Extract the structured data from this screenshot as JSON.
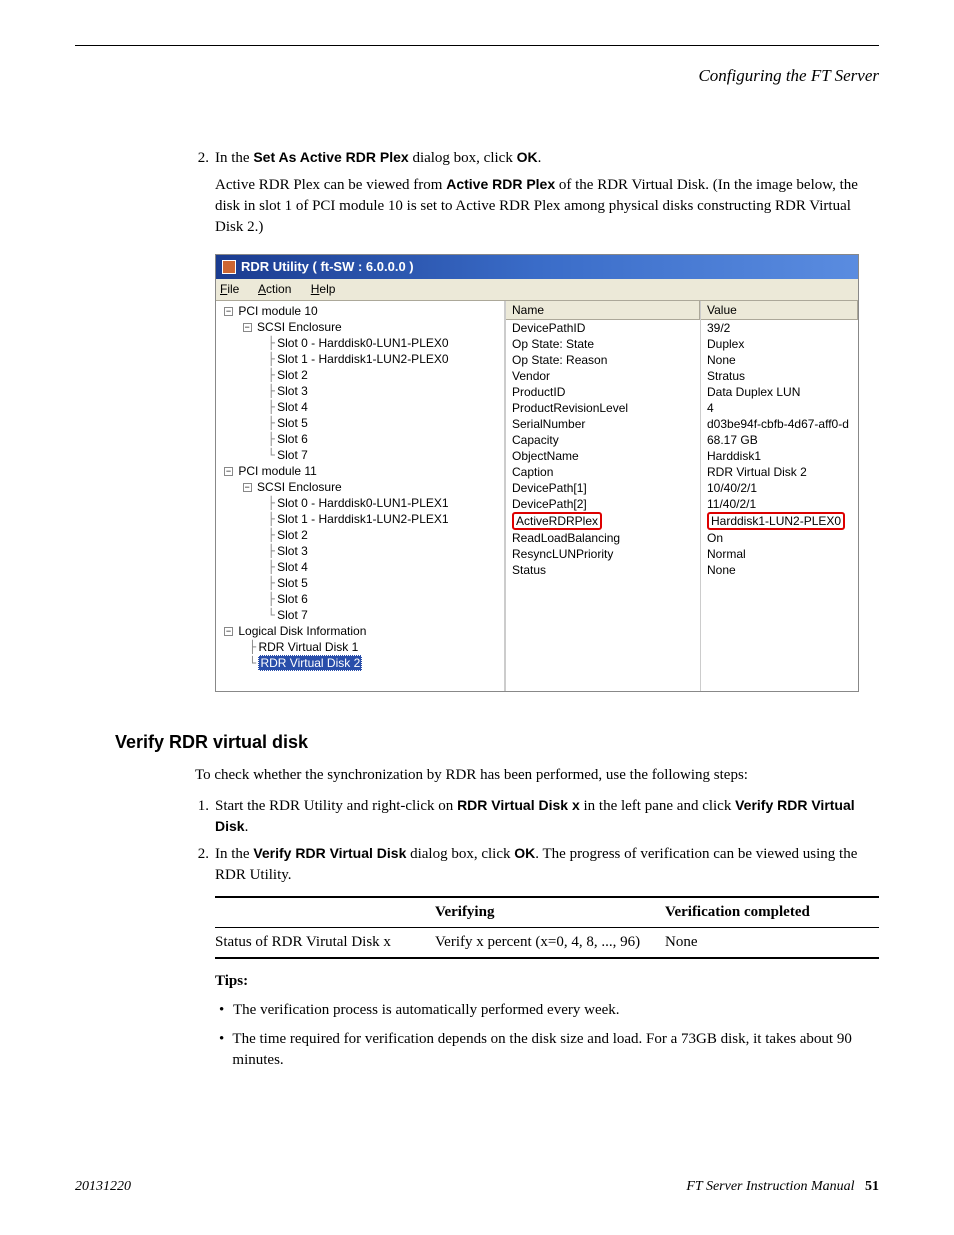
{
  "header": {
    "running": "Configuring the FT Server"
  },
  "step2": {
    "num": "2.",
    "lead": "In the ",
    "bold1": "Set As Active RDR Plex",
    "mid": " dialog box, click ",
    "bold2": "OK",
    "tail": ".",
    "para_a": "Active RDR Plex can be viewed from ",
    "para_bold": "Active RDR Plex",
    "para_b": " of the RDR Virtual Disk. (In the image below, the disk in slot 1 of PCI module 10 is set to Active RDR Plex among physical disks constructing RDR Virtual Disk 2.)"
  },
  "screenshot": {
    "title": "RDR Utility  ( ft-SW : 6.0.0.0 )",
    "menus": {
      "file": "File",
      "action": "Action",
      "help": "Help"
    },
    "tree": {
      "n0": "PCI module 10",
      "n0a": "SCSI Enclosure",
      "s0": "Slot 0  -  Harddisk0-LUN1-PLEX0",
      "s1": "Slot 1  -  Harddisk1-LUN2-PLEX0",
      "s2": "Slot 2",
      "s3": "Slot 3",
      "s4": "Slot 4",
      "s5": "Slot 5",
      "s6": "Slot 6",
      "s7": "Slot 7",
      "n1": "PCI module 11",
      "n1a": "SCSI Enclosure",
      "t0": "Slot 0  -  Harddisk0-LUN1-PLEX1",
      "t1": "Slot 1  -  Harddisk1-LUN2-PLEX1",
      "t2": "Slot 2",
      "t3": "Slot 3",
      "t4": "Slot 4",
      "t5": "Slot 5",
      "t6": "Slot 6",
      "t7": "Slot 7",
      "ldi": "Logical Disk Information",
      "rvd1": "RDR Virtual Disk 1",
      "rvd2": "RDR Virtual Disk 2"
    },
    "props": {
      "head_name": "Name",
      "head_value": "Value",
      "rows": [
        {
          "n": "DevicePathID",
          "v": "39/2"
        },
        {
          "n": "Op State: State",
          "v": "Duplex"
        },
        {
          "n": "Op State: Reason",
          "v": "None"
        },
        {
          "n": "Vendor",
          "v": "Stratus"
        },
        {
          "n": "ProductID",
          "v": "Data Duplex LUN"
        },
        {
          "n": "ProductRevisionLevel",
          "v": "4"
        },
        {
          "n": "SerialNumber",
          "v": "d03be94f-cbfb-4d67-aff0-d"
        },
        {
          "n": "Capacity",
          "v": "68.17 GB"
        },
        {
          "n": "ObjectName",
          "v": "Harddisk1"
        },
        {
          "n": "Caption",
          "v": "RDR Virtual Disk 2"
        },
        {
          "n": "DevicePath[1]",
          "v": "10/40/2/1"
        },
        {
          "n": "DevicePath[2]",
          "v": "11/40/2/1"
        },
        {
          "n": "ActiveRDRPlex",
          "v": "Harddisk1-LUN2-PLEX0",
          "hl": true
        },
        {
          "n": "ReadLoadBalancing",
          "v": "On"
        },
        {
          "n": "ResyncLUNPriority",
          "v": "Normal"
        },
        {
          "n": "Status",
          "v": "None"
        }
      ]
    }
  },
  "section2": {
    "heading": "Verify RDR virtual disk",
    "intro": "To check whether the synchronization by RDR has been performed, use the following steps:",
    "s1": {
      "num": "1.",
      "a": "Start the RDR Utility and right-click on ",
      "b1": "RDR Virtual Disk x",
      "b": " in the left pane and click ",
      "b2": "Verify RDR Virtual Disk",
      "c": "."
    },
    "s2": {
      "num": "2.",
      "a": "In the ",
      "b1": "Verify RDR Virtual Disk",
      "b": " dialog box, click ",
      "b2": "OK",
      "c": ". The progress of verification can be viewed using the RDR Utility."
    },
    "table": {
      "h1": "",
      "h2": "Verifying",
      "h3": "Verification completed",
      "r1c1": "Status of RDR Virutal Disk x",
      "r1c2": "Verify x percent (x=0, 4, 8, ..., 96)",
      "r1c3": "None"
    },
    "tips_label": "Tips:",
    "tip1": "The verification process is automatically performed every week.",
    "tip2": "The time required for verification depends on the disk size and load. For a 73GB disk, it takes about 90 minutes."
  },
  "footer": {
    "left": "20131220",
    "right_a": "FT Server Instruction Manual",
    "right_b": "51"
  }
}
